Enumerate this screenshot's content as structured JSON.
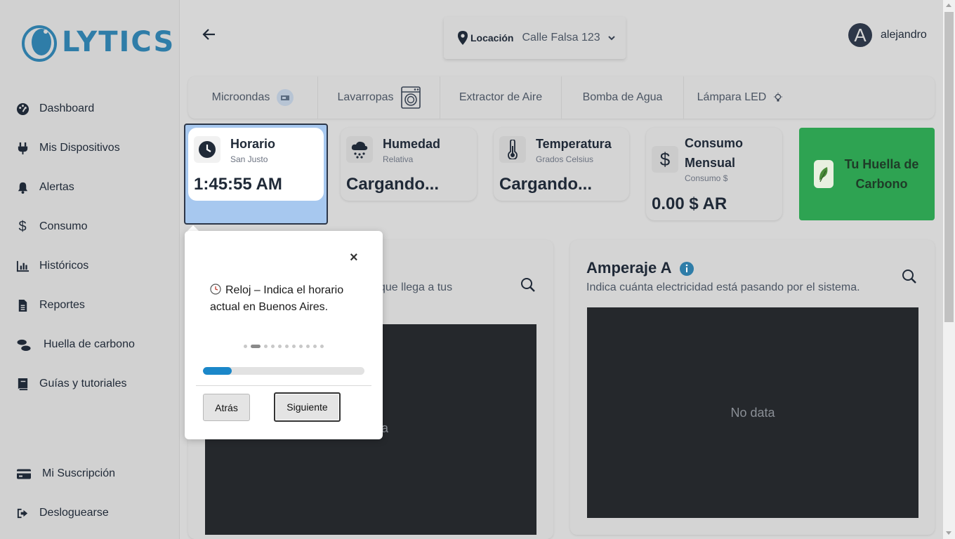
{
  "brand": {
    "name": "LYTICS",
    "color": "#2f7da8"
  },
  "sidebar": {
    "items": [
      {
        "label": "Dashboard",
        "icon": "dashboard-icon"
      },
      {
        "label": "Mis Dispositivos",
        "icon": "plug-icon"
      },
      {
        "label": "Alertas",
        "icon": "bell-icon"
      },
      {
        "label": "Consumo",
        "icon": "dollar-icon"
      },
      {
        "label": "Históricos",
        "icon": "bar-chart-icon"
      },
      {
        "label": "Reportes",
        "icon": "file-icon"
      },
      {
        "label": "Huella de carbono",
        "icon": "footprints-icon"
      },
      {
        "label": "Guías y tutoriales",
        "icon": "book-icon"
      }
    ],
    "bottom": [
      {
        "label": "Mi Suscripción",
        "icon": "credit-card-icon"
      },
      {
        "label": "Desloguearse",
        "icon": "logout-icon"
      }
    ]
  },
  "header": {
    "location_label": "Locación",
    "location_value": "Calle Falsa 123",
    "user_initial": "A",
    "user_name": "alejandro"
  },
  "tabs": [
    {
      "label": "Microondas",
      "icon": "microwave-icon"
    },
    {
      "label": "Lavarropas",
      "icon": "washing-machine-icon"
    },
    {
      "label": "Extractor de Aire",
      "icon": ""
    },
    {
      "label": "Bomba de Agua",
      "icon": ""
    },
    {
      "label": "Lámpara LED",
      "icon": "lightbulb-icon"
    }
  ],
  "cards": {
    "horario": {
      "title": "Horario",
      "sub": "San Justo",
      "value": "1:45:55 AM"
    },
    "humedad": {
      "title": "Humedad",
      "sub": "Relativa",
      "value": "Cargando..."
    },
    "temperatura": {
      "title": "Temperatura",
      "sub": "Grados Celsius",
      "value": "Cargando..."
    },
    "consumo": {
      "title_line1": "Consumo",
      "title_line2": "Mensual",
      "sub": "Consumo $",
      "value": "0.00 $ AR"
    },
    "huella": {
      "label_line1": "Tu Huella de",
      "label_line2": "Carbono",
      "color": "#2ea352"
    }
  },
  "panels": {
    "left": {
      "desc_fragment": "que llega a tus",
      "nodata_fragment": "ta"
    },
    "right": {
      "title": "Amperaje A",
      "desc": "Indica cuánta electricidad está pasando por el sistema.",
      "nodata": "No data"
    }
  },
  "tour": {
    "text": "Reloj – Indica el horario actual en Buenos Aires.",
    "step": 2,
    "total_steps": 11,
    "progress": 0.18,
    "back_label": "Atrás",
    "next_label": "Siguiente",
    "close_glyph": "×",
    "accent": "#1b87c9"
  }
}
